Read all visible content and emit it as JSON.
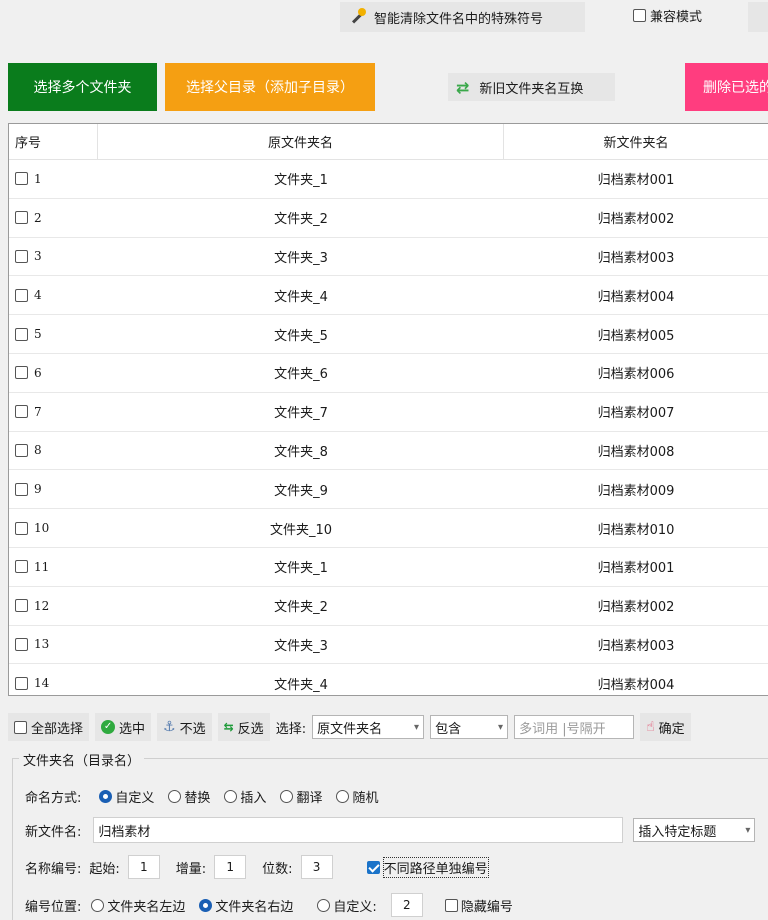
{
  "toolbar": {
    "clean_label": "智能清除文件名中的特殊符号",
    "compat_label": "兼容模式"
  },
  "actions": {
    "select_multi": "选择多个文件夹",
    "select_parent": "选择父目录（添加子目录）",
    "swap_names": "新旧文件夹名互换",
    "delete_selected": "删除已选的"
  },
  "table": {
    "headers": [
      "序号",
      "原文件夹名",
      "新文件夹名"
    ],
    "rows": [
      {
        "idx": "1",
        "orig": "文件夹_1",
        "new": "归档素材001"
      },
      {
        "idx": "2",
        "orig": "文件夹_2",
        "new": "归档素材002"
      },
      {
        "idx": "3",
        "orig": "文件夹_3",
        "new": "归档素材003"
      },
      {
        "idx": "4",
        "orig": "文件夹_4",
        "new": "归档素材004"
      },
      {
        "idx": "5",
        "orig": "文件夹_5",
        "new": "归档素材005"
      },
      {
        "idx": "6",
        "orig": "文件夹_6",
        "new": "归档素材006"
      },
      {
        "idx": "7",
        "orig": "文件夹_7",
        "new": "归档素材007"
      },
      {
        "idx": "8",
        "orig": "文件夹_8",
        "new": "归档素材008"
      },
      {
        "idx": "9",
        "orig": "文件夹_9",
        "new": "归档素材009"
      },
      {
        "idx": "10",
        "orig": "文件夹_10",
        "new": "归档素材010"
      },
      {
        "idx": "11",
        "orig": "文件夹_1",
        "new": "归档素材001"
      },
      {
        "idx": "12",
        "orig": "文件夹_2",
        "new": "归档素材002"
      },
      {
        "idx": "13",
        "orig": "文件夹_3",
        "new": "归档素材003"
      },
      {
        "idx": "14",
        "orig": "文件夹_4",
        "new": "归档素材004"
      }
    ]
  },
  "filter": {
    "select_all": "全部选择",
    "select": "选中",
    "deselect": "不选",
    "invert": "反选",
    "choose_label": "选择:",
    "field_value": "原文件夹名",
    "match_value": "包含",
    "keyword_placeholder": "多词用 |号隔开",
    "confirm": "确定"
  },
  "naming": {
    "group_title": "文件夹名（目录名）",
    "mode_label": "命名方式:",
    "modes": [
      "自定义",
      "替换",
      "插入",
      "翻译",
      "随机"
    ],
    "new_name_label": "新文件名:",
    "new_name_value": "归档素材",
    "insert_title": "插入特定标题",
    "num_label": "名称编号:",
    "start_label": "起始:",
    "start_value": "1",
    "step_label": "增量:",
    "step_value": "1",
    "digits_label": "位数:",
    "digits_value": "3",
    "separate_label": "不同路径单独编号",
    "pos_label": "编号位置:",
    "pos_left": "文件夹名左边",
    "pos_right": "文件夹名右边",
    "pos_custom": "自定义:",
    "pos_custom_value": "2",
    "hide_num": "隐藏编号"
  }
}
